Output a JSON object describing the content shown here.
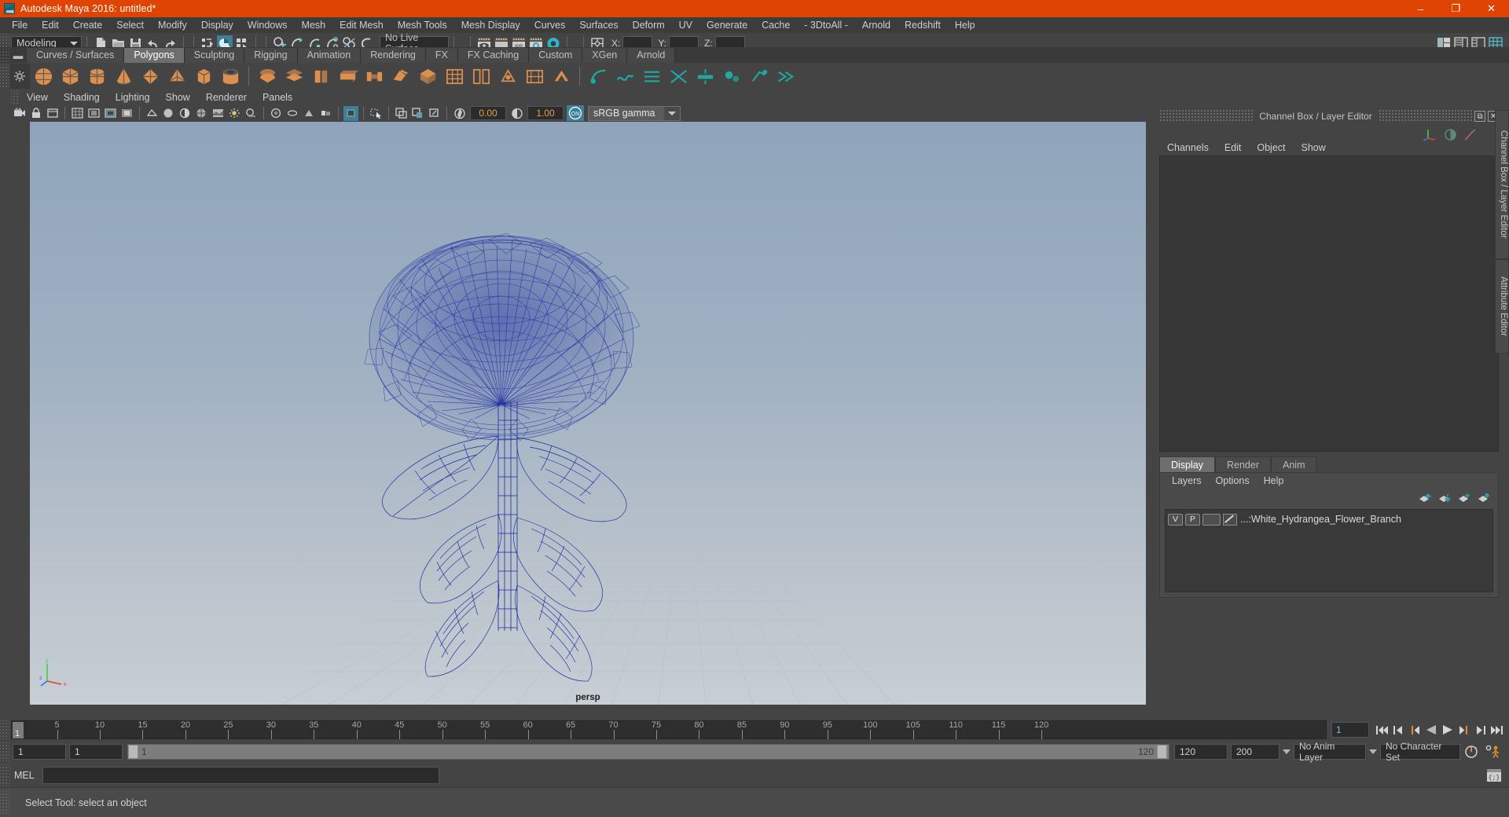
{
  "window": {
    "title": "Autodesk Maya 2016: untitled*",
    "app_icon": "maya-logo-icon",
    "minimize_label": "–",
    "maximize_label": "❐",
    "close_label": "✕"
  },
  "menubar": {
    "items": [
      "File",
      "Edit",
      "Create",
      "Select",
      "Modify",
      "Display",
      "Windows",
      "Mesh",
      "Edit Mesh",
      "Mesh Tools",
      "Mesh Display",
      "Curves",
      "Surfaces",
      "Deform",
      "UV",
      "Generate",
      "Cache",
      "- 3DtoAll -",
      "Arnold",
      "Redshift",
      "Help"
    ]
  },
  "statusline": {
    "menuset": "Modeling",
    "live_surface": "No Live Surface",
    "x_label": "X:",
    "y_label": "Y:",
    "z_label": "Z:",
    "x_value": "",
    "y_value": "",
    "z_value": "",
    "ipr_label": "IPR"
  },
  "shelf": {
    "tabs": [
      "Curves / Surfaces",
      "Polygons",
      "Sculpting",
      "Rigging",
      "Animation",
      "Rendering",
      "FX",
      "FX Caching",
      "Custom",
      "XGen",
      "Arnold"
    ],
    "active_tab": "Polygons",
    "icons": [
      "poly-sphere",
      "poly-cube",
      "poly-cylinder",
      "poly-cone",
      "poly-torus",
      "poly-pyramid",
      "poly-prism",
      "poly-pipe",
      "poly-combine",
      "poly-separate",
      "poly-extrude",
      "poly-bevel",
      "poly-bridge",
      "poly-append",
      "poly-wedge",
      "poly-smooth",
      "poly-reduce",
      "poly-booleans",
      "sculpt-grab",
      "sculpt-smooth",
      "sculpt-relax",
      "sculpt-pinch",
      "sculpt-flatten",
      "sculpt-foamy",
      "sculpt-spray",
      "sculpt-repeat"
    ]
  },
  "viewport": {
    "menus": [
      "View",
      "Shading",
      "Lighting",
      "Show",
      "Renderer",
      "Panels"
    ],
    "camera_label": "persp",
    "exposure_value": "0.00",
    "gamma_value": "1.00",
    "color_profile": "sRGB gamma",
    "toggle_on_label": "ON",
    "axis_labels": {
      "x": "x",
      "y": "y",
      "z": "z"
    },
    "model": "white-hydrangea-flower-branch-wireframe",
    "wire_color": "#1b2aa0"
  },
  "channel_box": {
    "panel_title": "Channel Box / Layer Editor",
    "menus": [
      "Channels",
      "Edit",
      "Object",
      "Show"
    ],
    "float_button": "⧉",
    "close_button": "✕"
  },
  "layer_editor": {
    "tabs": [
      "Display",
      "Render",
      "Anim"
    ],
    "active_tab": "Display",
    "menus": [
      "Layers",
      "Options",
      "Help"
    ],
    "buttons": [
      "move-layer-up-icon",
      "move-layer-down-icon",
      "new-layer-icon",
      "new-layer-from-selected-icon"
    ],
    "layers": [
      {
        "visibility": "V",
        "playback": "P",
        "shading": "",
        "name": "...:White_Hydrangea_Flower_Branch"
      }
    ]
  },
  "side_tabs": [
    "Channel Box / Layer Editor",
    "Attribute Editor"
  ],
  "timeline": {
    "tick_labels": [
      "5",
      "10",
      "15",
      "20",
      "25",
      "30",
      "35",
      "40",
      "45",
      "50",
      "55",
      "60",
      "65",
      "70",
      "75",
      "80",
      "85",
      "90",
      "95",
      "100",
      "105",
      "110",
      "115",
      "120"
    ],
    "current_frame": "1",
    "playhead_label": "1",
    "transport": [
      "go-to-start-icon",
      "step-back-frame-icon",
      "step-back-key-icon",
      "play-backwards-icon",
      "play-forwards-icon",
      "step-forward-key-icon",
      "step-forward-frame-icon",
      "go-to-end-icon"
    ]
  },
  "range_slider": {
    "anim_start": "1",
    "range_start": "1",
    "range_handle_label": "1",
    "range_end_label": "120",
    "range_end": "120",
    "anim_end": "200",
    "anim_layer": "No Anim Layer",
    "character_set": "No Character Set",
    "auto_key_icon": "auto-keyframe-icon",
    "anim_prefs_icon": "animation-preferences-icon"
  },
  "command_line": {
    "language_label": "MEL",
    "value": "",
    "script_editor_icon": "script-editor-icon"
  },
  "status_bar": {
    "message": "Select Tool: select an object"
  },
  "toolbox": {
    "tools": [
      {
        "name": "select-tool",
        "selected": true
      },
      {
        "name": "lasso-select-tool",
        "selected": false
      },
      {
        "name": "paint-select-tool",
        "selected": false
      },
      {
        "name": "move-tool",
        "selected": false
      },
      {
        "name": "rotate-tool",
        "selected": false
      },
      {
        "name": "scale-tool",
        "selected": false
      },
      {
        "name": "last-tool-used",
        "selected": false
      },
      {
        "name": "layout-single-perspective",
        "selected": false
      },
      {
        "name": "layout-four-view",
        "selected": false
      },
      {
        "name": "layout-persp-outliner",
        "selected": false
      },
      {
        "name": "layout-persp-graph-editor",
        "selected": false
      },
      {
        "name": "layout-hypershade-persp",
        "selected": false
      },
      {
        "name": "layout-persp-trax",
        "selected": false
      },
      {
        "name": "layout-more",
        "selected": false
      }
    ]
  },
  "colors": {
    "title_bar": "#e04403",
    "accent": "#3e7e96",
    "panel_bg": "#444444",
    "shelf_icon": "#dd8f4e",
    "wireframe": "#1b2aa0"
  }
}
